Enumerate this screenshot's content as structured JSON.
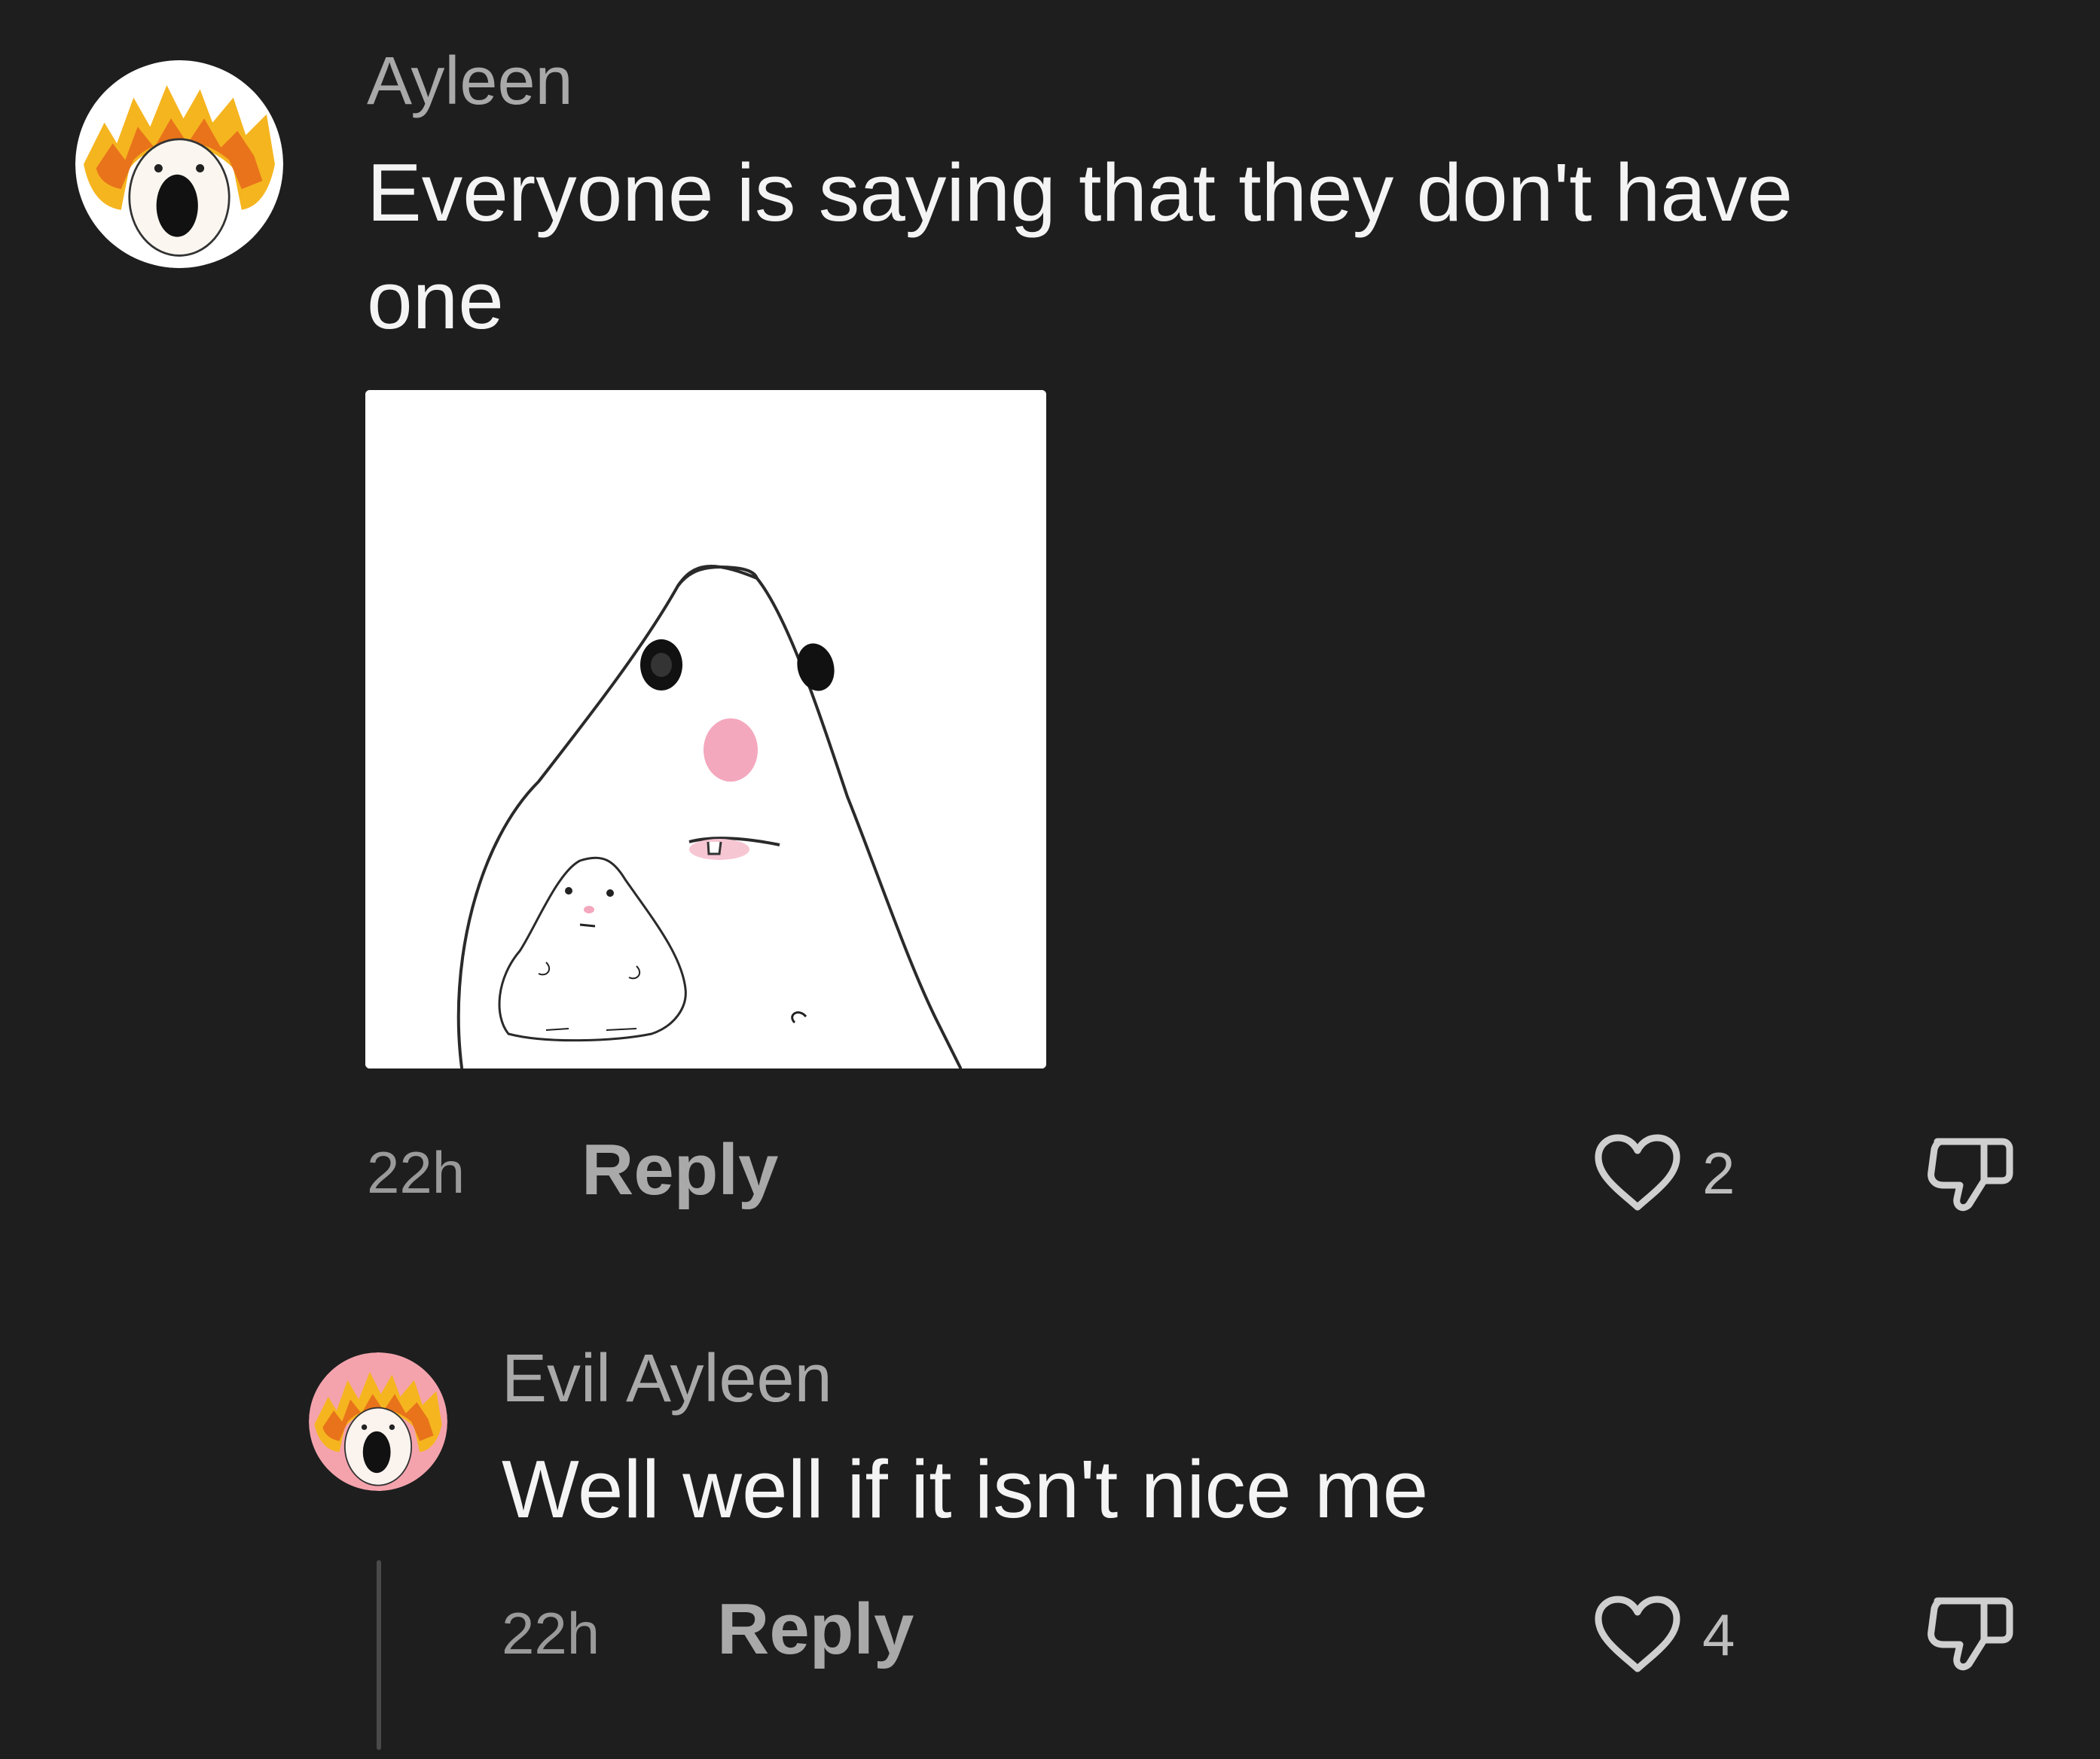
{
  "comments": [
    {
      "username": "Ayleen",
      "text_line1": "Everyone is saying that they don't have",
      "text_line2": "one",
      "time": "22h",
      "reply_label": "Reply",
      "likes": "2",
      "avatar_icon": "flaming-screaming-hamster-avatar",
      "attachment_icon": "big-hamster-holding-small-hamster-drawing"
    },
    {
      "username": "Evil Ayleen",
      "text": "Well well if it isn't nice me",
      "time": "22h",
      "reply_label": "Reply",
      "likes": "4",
      "avatar_icon": "flaming-screaming-hamster-avatar-pink"
    }
  ],
  "icons": {
    "like": "heart-outline-icon",
    "dislike": "thumbs-down-outline-icon"
  },
  "colors": {
    "background": "#1e1e1e",
    "text_primary": "#f4f4f4",
    "text_secondary": "#a9a9a9",
    "avatar_flame": "#f5a623",
    "reply_avatar_bg": "#f4a3ad"
  }
}
